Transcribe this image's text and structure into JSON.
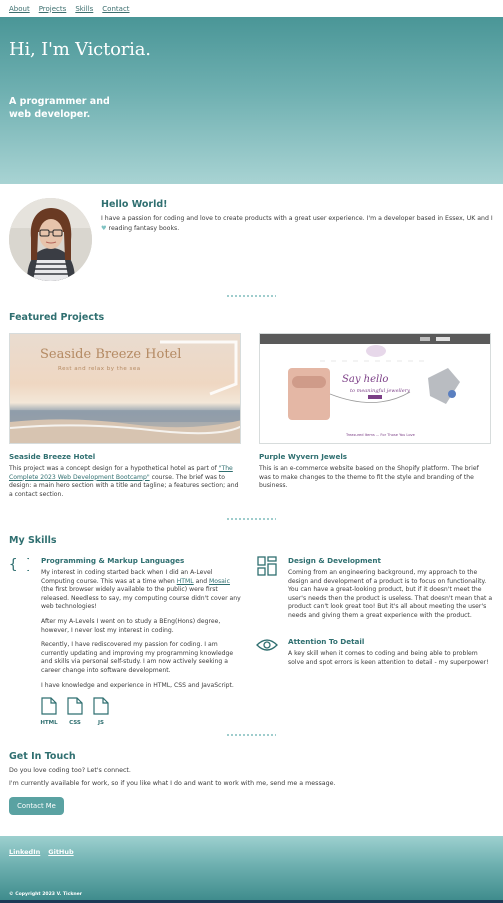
{
  "nav": {
    "items": [
      "About",
      "Projects",
      "Skills",
      "Contact"
    ]
  },
  "hero": {
    "title": "Hi, I'm Victoria.",
    "tagline": "A programmer and web developer."
  },
  "intro": {
    "title": "Hello World!",
    "text_before_heart": "I have a passion for coding and love to create products with a great user experience. I'm a developer based in Essex, UK and I",
    "heart": "♥",
    "text_after_heart": "reading fantasy books."
  },
  "projects": {
    "title": "Featured Projects",
    "items": [
      {
        "title": "Seaside Breeze Hotel",
        "image_title": "Seaside Breeze Hotel",
        "image_subtitle": "Rest and relax by the sea",
        "desc_before_link": "This project was a concept design for a hypothetical hotel as part of ",
        "link": "\"The Complete 2023 Web Development Bootcamp\"",
        "desc_after_link": " course. The brief was to design: a main hero section with a title and tagline; a features section; and a contact section."
      },
      {
        "title": "Purple Wyvern Jewels",
        "image_title": "Say hello",
        "image_subtitle": "to meaningful jewellery",
        "image_caption": "Treasured Items ... For Those You Love",
        "desc": "This is an e-commerce website based on the Shopify platform. The brief was to make changes to the theme to fit the style and branding of the business."
      }
    ]
  },
  "skills": {
    "title": "My Skills",
    "programming": {
      "title": "Programming & Markup Languages",
      "p1_a": "My interest in coding started back when I did an A-Level Computing course. This was at a time when ",
      "p1_link1": "HTML",
      "p1_b": " and ",
      "p1_link2": "Mosaic",
      "p1_c": " (the first browser widely available to the public) were first released. Needless to say, my computing course didn't cover any web technologies!",
      "p2": "After my A-Levels I went on to study a BEng(Hons) degree, however, I never lost my interest in coding.",
      "p3": "Recently, I have rediscovered my passion for coding. I am currently updating and improving my programming knowledge and skills via personal self-study. I am now actively seeking a career change into software development.",
      "p4": "I have knowledge and experience in HTML, CSS and JavaScript.",
      "files": [
        "HTML",
        "CSS",
        "JS"
      ]
    },
    "design": {
      "title": "Design & Development",
      "text": "Coming from an engineering background, my approach to the design and development of a product is to focus on functionality. You can have a great-looking product, but if it doesn't meet the user's needs then the product is useless. That doesn't mean that a product can't look great too! But it's all about meeting the user's needs and giving them a great experience with the product."
    },
    "detail": {
      "title": "Attention To Detail",
      "text": "A key skill when it comes to coding and being able to problem solve and spot errors is keen attention to detail - my superpower!"
    }
  },
  "contact": {
    "title": "Get In Touch",
    "line1": "Do you love coding too? Let's connect.",
    "line2": "I'm currently available for work, so if you like what I do and want to work with me, send me a message.",
    "button": "Contact Me"
  },
  "footer": {
    "links": [
      "LinkedIn",
      "GitHub"
    ],
    "copyright": "© Copyright 2023 V. Tickner"
  },
  "colors": {
    "accent": "#2f6f70",
    "hero_top": "#4a9697",
    "hero_bottom": "#a8d3d3",
    "button": "#5aa2a2"
  }
}
